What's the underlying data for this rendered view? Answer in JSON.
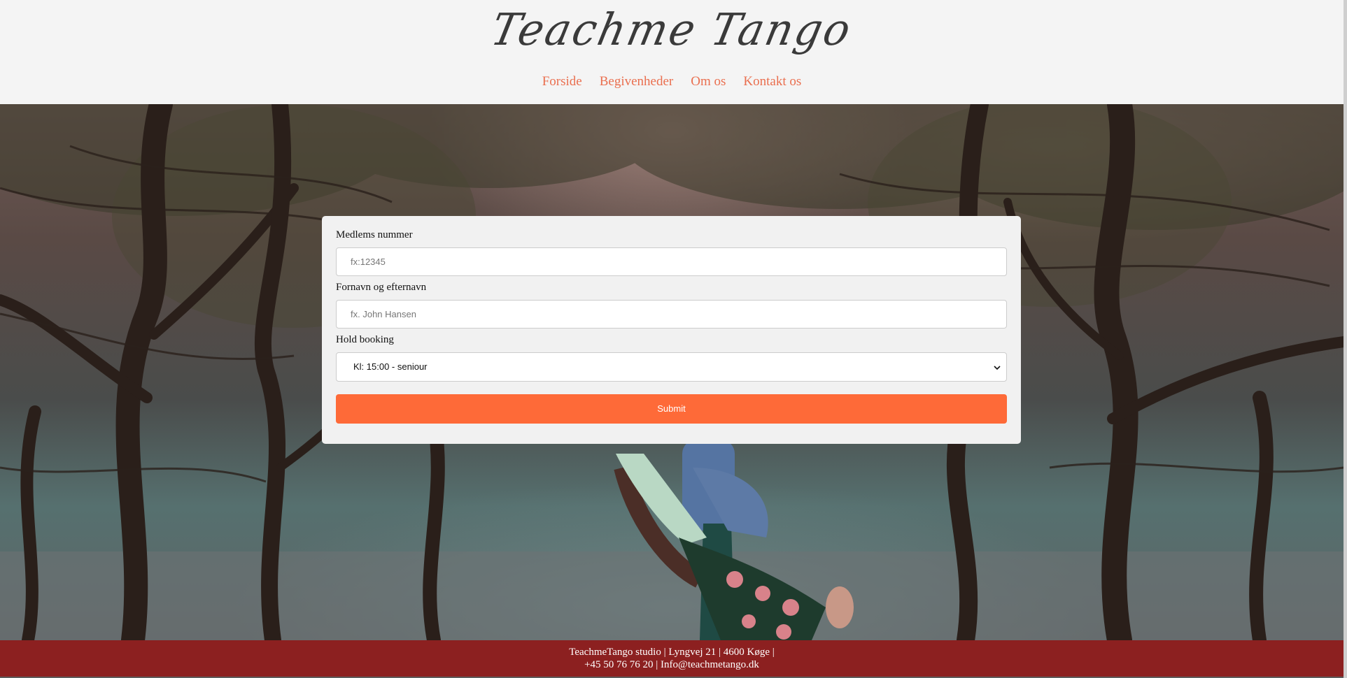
{
  "header": {
    "logo_text": "Teachme Tango",
    "nav": [
      {
        "label": "Forside"
      },
      {
        "label": "Begivenheder"
      },
      {
        "label": "Om os"
      },
      {
        "label": "Kontakt os"
      }
    ]
  },
  "colors": {
    "nav_link": "#ea6f4f",
    "submit_bg": "#fe6a38",
    "footer_bg": "#8c2020",
    "header_bg": "#f4f4f4"
  },
  "form": {
    "member_label": "Medlems nummer",
    "member_placeholder": "fx:12345",
    "name_label": "Fornavn og efternavn",
    "name_placeholder": "fx. John Hansen",
    "booking_label": "Hold booking",
    "booking_selected": "Kl: 15:00 - seniour",
    "submit_label": "Submit"
  },
  "footer": {
    "line1": "TeachmeTango studio | Lyngvej 21 | 4600 Køge |",
    "line2": "+45 50 76 76 20 | Info@teachmetango.dk"
  },
  "icons": {
    "select_arrow": "chevron-down-icon"
  }
}
